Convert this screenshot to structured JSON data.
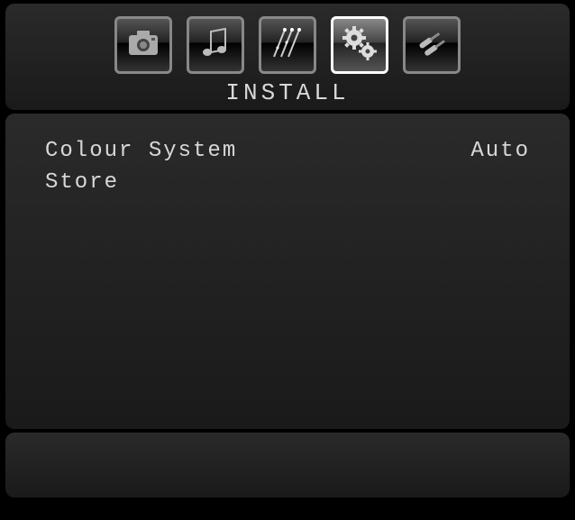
{
  "header": {
    "title": "INSTALL",
    "tabs": [
      {
        "name": "picture",
        "icon": "camera-icon",
        "active": false
      },
      {
        "name": "sound",
        "icon": "music-icon",
        "active": false
      },
      {
        "name": "features",
        "icon": "sparks-icon",
        "active": false
      },
      {
        "name": "install",
        "icon": "gears-icon",
        "active": true
      },
      {
        "name": "source",
        "icon": "cables-icon",
        "active": false
      }
    ]
  },
  "menu": {
    "items": [
      {
        "label": "Colour System",
        "value": "Auto"
      },
      {
        "label": "Store",
        "value": ""
      }
    ]
  }
}
